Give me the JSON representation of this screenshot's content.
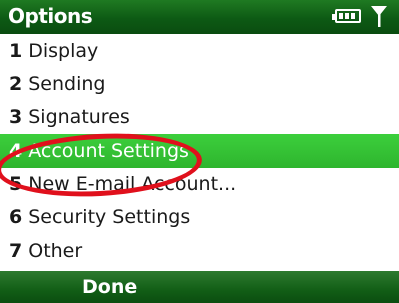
{
  "header": {
    "title": "Options",
    "battery_icon": "battery-icon",
    "signal_icon": "signal-icon",
    "accent": "#0d5a14"
  },
  "menu": {
    "items": [
      {
        "num": "1",
        "label": "Display"
      },
      {
        "num": "2",
        "label": "Sending"
      },
      {
        "num": "3",
        "label": "Signatures"
      },
      {
        "num": "4",
        "label": "Account Settings",
        "selected": true
      },
      {
        "num": "5",
        "label": "New E-mail Account..."
      },
      {
        "num": "6",
        "label": "Security Settings"
      },
      {
        "num": "7",
        "label": "Other"
      }
    ],
    "selected_color": "#33c233"
  },
  "annotation": {
    "color": "#e0101c"
  },
  "softkeys": {
    "left": "Done"
  }
}
